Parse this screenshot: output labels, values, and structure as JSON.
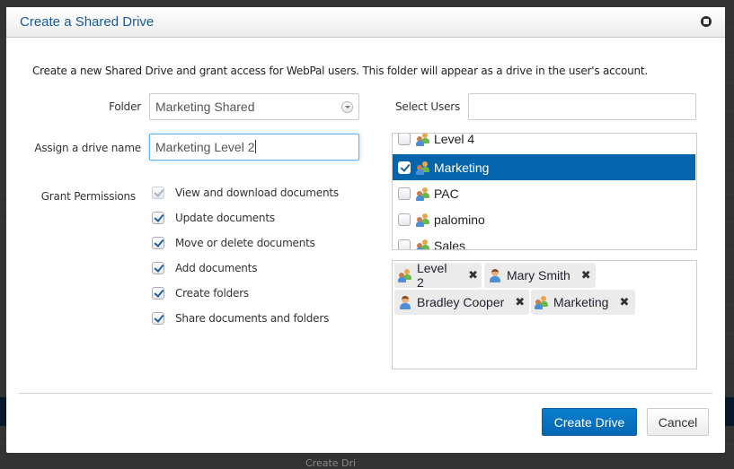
{
  "dialog": {
    "title": "Create a Shared Drive",
    "intro": "Create a new Shared Drive and grant access for WebPal users. This folder will appear as a drive in the user's account."
  },
  "form": {
    "folder_label": "Folder",
    "folder_value": "Marketing Shared",
    "drive_name_label": "Assign a drive name",
    "drive_name_value": "Marketing Level 2",
    "permissions_label": "Grant Permissions",
    "permissions": [
      {
        "label": "View and download documents",
        "checked": true,
        "disabled": true
      },
      {
        "label": "Update documents",
        "checked": true,
        "disabled": false
      },
      {
        "label": "Move or delete documents",
        "checked": true,
        "disabled": false
      },
      {
        "label": "Add documents",
        "checked": true,
        "disabled": false
      },
      {
        "label": "Create folders",
        "checked": true,
        "disabled": false
      },
      {
        "label": "Share documents and folders",
        "checked": true,
        "disabled": false
      }
    ]
  },
  "users": {
    "select_label": "Select Users",
    "search_value": "",
    "list": [
      {
        "name": "Level 4",
        "type": "group",
        "checked": false,
        "selected": false
      },
      {
        "name": "Marketing",
        "type": "group",
        "checked": true,
        "selected": true
      },
      {
        "name": "PAC",
        "type": "group",
        "checked": false,
        "selected": false
      },
      {
        "name": "palomino",
        "type": "group",
        "checked": false,
        "selected": false
      },
      {
        "name": "Sales",
        "type": "group",
        "checked": false,
        "selected": false
      }
    ],
    "selected_tags": [
      {
        "name": "Level 2",
        "type": "group",
        "remove_icon": "close-icon"
      },
      {
        "name": "Mary Smith",
        "type": "user",
        "remove_icon": "close-icon"
      },
      {
        "name": "Bradley Cooper",
        "type": "user",
        "remove_icon": "close-icon"
      },
      {
        "name": "Marketing",
        "type": "group",
        "remove_icon": "close-icon"
      }
    ]
  },
  "footer": {
    "create_label": "Create Drive",
    "cancel_label": "Cancel"
  },
  "colors": {
    "primary": "#0467b3",
    "selected_row": "#0465ac",
    "title": "#1a5a96"
  },
  "background": {
    "partial_text": "Create Dri"
  }
}
